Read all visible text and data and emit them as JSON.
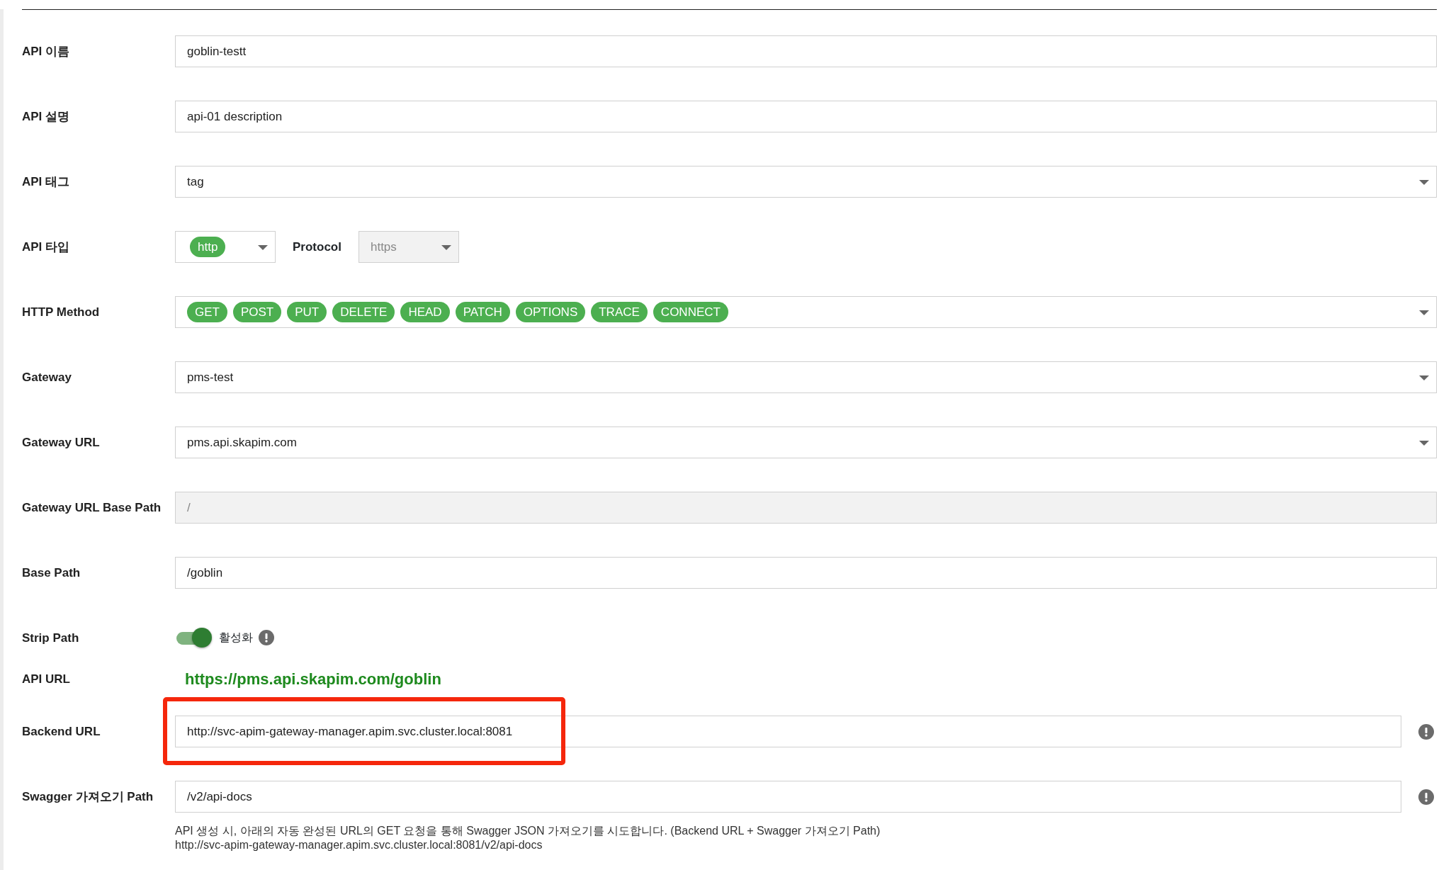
{
  "rows": [
    {
      "kind": "text",
      "label": "API 이름",
      "value": "goblin-testt",
      "disabled": false
    },
    {
      "kind": "text",
      "label": "API 설명",
      "value": "api-01 description",
      "disabled": false
    },
    {
      "kind": "select",
      "label": "API 태그",
      "value": "tag"
    },
    {
      "kind": "apitype",
      "label": "API 타입",
      "type_value": "http",
      "protocol_label": "Protocol",
      "protocol_value": "https",
      "protocol_disabled": true
    },
    {
      "kind": "methods",
      "label": "HTTP Method",
      "methods": [
        "GET",
        "POST",
        "PUT",
        "DELETE",
        "HEAD",
        "PATCH",
        "OPTIONS",
        "TRACE",
        "CONNECT"
      ]
    },
    {
      "kind": "select",
      "label": "Gateway",
      "value": "pms-test"
    },
    {
      "kind": "select",
      "label": "Gateway URL",
      "value": "pms.api.skapim.com"
    },
    {
      "kind": "text",
      "label": "Gateway URL Base Path",
      "value": "/",
      "disabled": true
    },
    {
      "kind": "text",
      "label": "Base Path",
      "value": "/goblin",
      "disabled": false
    },
    {
      "kind": "toggle",
      "label": "Strip Path",
      "on": true,
      "toggle_label": "활성화"
    },
    {
      "kind": "link",
      "label": "API URL",
      "value": "https://pms.api.skapim.com/goblin"
    },
    {
      "kind": "info",
      "label": "Backend URL",
      "value": "http://svc-apim-gateway-manager.apim.svc.cluster.local:8081",
      "highlighted": true
    },
    {
      "kind": "info",
      "label": "Swagger 가져오기 Path",
      "value": "/v2/api-docs",
      "highlighted": false,
      "help": [
        "API 생성 시, 아래의 자동 완성된 URL의 GET 요청을 통해 Swagger JSON 가져오기를 시도합니다. (Backend URL + Swagger 가져오기 Path)",
        "http://svc-apim-gateway-manager.apim.svc.cluster.local:8081/v2/api-docs"
      ]
    }
  ]
}
